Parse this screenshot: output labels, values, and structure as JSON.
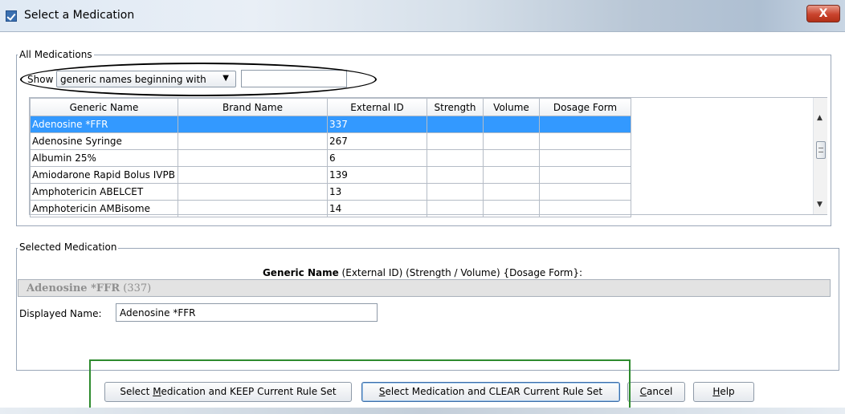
{
  "window": {
    "title": "Select a Medication",
    "close_label": "X"
  },
  "all_medications": {
    "legend": "All Medications",
    "show_label": "Show",
    "filter_option": "generic names beginning with",
    "filter_value": "",
    "columns": [
      "Generic Name",
      "Brand Name",
      "External ID",
      "Strength",
      "Volume",
      "Dosage Form"
    ],
    "rows": [
      {
        "generic": "Adenosine *FFR",
        "brand": "",
        "external_id": "337",
        "strength": "",
        "volume": "",
        "form": "",
        "selected": true
      },
      {
        "generic": "Adenosine Syringe",
        "brand": "",
        "external_id": "267",
        "strength": "",
        "volume": "",
        "form": ""
      },
      {
        "generic": "Albumin 25%",
        "brand": "",
        "external_id": "6",
        "strength": "",
        "volume": "",
        "form": ""
      },
      {
        "generic": "Amiodarone Rapid Bolus IVPB",
        "brand": "",
        "external_id": "139",
        "strength": "",
        "volume": "",
        "form": ""
      },
      {
        "generic": "Amphotericin ABELCET",
        "brand": "",
        "external_id": "13",
        "strength": "",
        "volume": "",
        "form": ""
      },
      {
        "generic": "Amphotericin AMBisome",
        "brand": "",
        "external_id": "14",
        "strength": "",
        "volume": "",
        "form": ""
      }
    ]
  },
  "selected_medication": {
    "legend": "Selected Medication",
    "format_bold": "Generic Name",
    "format_rest": " (External ID)  (Strength / Volume)  {Dosage Form}:",
    "selected_bold": "Adenosine *FFR",
    "selected_rest": " (337)",
    "displayed_name_label": "Displayed Name:",
    "displayed_name_value": "Adenosine *FFR"
  },
  "buttons": {
    "keep_pre": "Select ",
    "keep_key": "M",
    "keep_post": "edication and KEEP Current Rule Set",
    "clear_pre": "",
    "clear_key": "S",
    "clear_post": "elect Medication and CLEAR Current Rule Set",
    "cancel_key": "C",
    "cancel_post": "ancel",
    "help_key": "H",
    "help_post": "elp"
  }
}
